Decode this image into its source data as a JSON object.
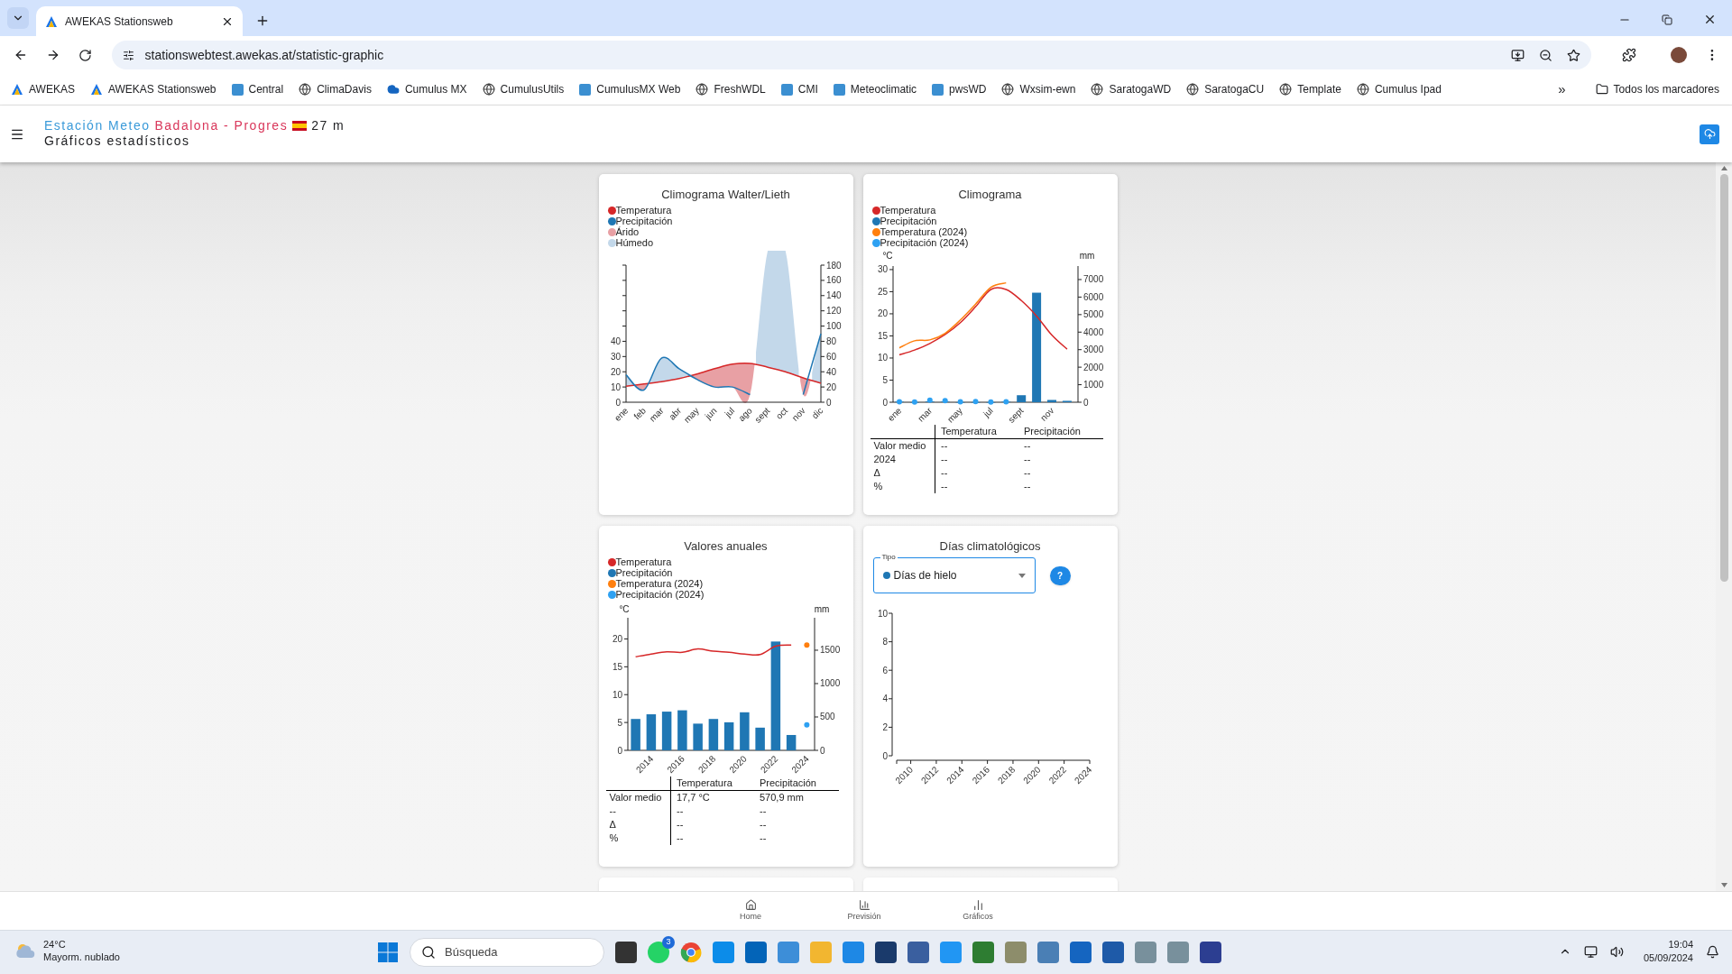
{
  "browser": {
    "tabs": [
      {
        "title": "AWEKAS Stationsweb",
        "selected": true
      }
    ],
    "url": "stationswebtest.awekas.at/statistic-graphic",
    "bookmarks": [
      {
        "label": "AWEKAS",
        "kind": "logo"
      },
      {
        "label": "AWEKAS Stationsweb",
        "kind": "logo"
      },
      {
        "label": "Central",
        "kind": "app"
      },
      {
        "label": "ClimaDavis",
        "kind": "globe"
      },
      {
        "label": "Cumulus MX",
        "kind": "cloud"
      },
      {
        "label": "CumulusUtils",
        "kind": "globe"
      },
      {
        "label": "CumulusMX Web",
        "kind": "app"
      },
      {
        "label": "FreshWDL",
        "kind": "globe"
      },
      {
        "label": "CMI",
        "kind": "app"
      },
      {
        "label": "Meteoclimatic",
        "kind": "app"
      },
      {
        "label": "pwsWD",
        "kind": "app"
      },
      {
        "label": "Wxsim-ewn",
        "kind": "globe"
      },
      {
        "label": "SaratogaWD",
        "kind": "globe"
      },
      {
        "label": "SaratogaCU",
        "kind": "globe"
      },
      {
        "label": "Template",
        "kind": "globe"
      },
      {
        "label": "Cumulus Ipad",
        "kind": "globe"
      }
    ],
    "overflow": "»",
    "all_bookmarks": "Todos los marcadores"
  },
  "header": {
    "title_part_1": "Estación Meteo",
    "title_part_2": "Badalona - Progres",
    "altitude": "27 m",
    "subtitle": "Gráficos estadísticos"
  },
  "cards": [
    {
      "kind": "walter",
      "title": "Climograma Walter/Lieth",
      "areas": [
        {
          "label": "Árido",
          "color": "#e8a0a4"
        },
        {
          "label": "Húmedo",
          "color": "#c3d8ea"
        }
      ],
      "chart_data": {
        "type": "line",
        "categories": [
          "ene",
          "feb",
          "mar",
          "abr",
          "may",
          "jun",
          "jul",
          "ago",
          "sept",
          "oct",
          "nov",
          "dic"
        ],
        "yticks": [
          0,
          10,
          20,
          30,
          40
        ],
        "ylim": [
          0,
          90
        ],
        "y2ticks": [
          0,
          20,
          40,
          60,
          80,
          100,
          120,
          140,
          160,
          180
        ],
        "y2lim": [
          0,
          180
        ],
        "series": [
          {
            "name": "Temperatura",
            "color": "#d62728",
            "values": [
              10.5,
              12,
              13.5,
              15.5,
              18.5,
              22,
              25,
              25.5,
              23,
              20,
              16,
              12.5
            ]
          },
          {
            "name": "Precipitación",
            "color": "#1f77b4",
            "axis": "y2",
            "values": [
              36,
              16,
              58,
              44,
              30,
              20,
              20,
              10,
              null,
              null,
              10,
              90
            ]
          }
        ]
      }
    },
    {
      "kind": "climogram",
      "title": "Climograma",
      "chart_data": {
        "type": "bar",
        "categories": [
          "ene",
          null,
          "mar",
          null,
          "may",
          null,
          "jul",
          null,
          "sept",
          null,
          "nov",
          null
        ],
        "ylabel": "°C",
        "y2label": "mm",
        "yticks": [
          0,
          5,
          10,
          15,
          20,
          25,
          30
        ],
        "ylim": [
          0,
          30.8
        ],
        "y2ticks": [
          0,
          1000,
          2000,
          3000,
          4000,
          5000,
          6000,
          7000
        ],
        "y2lim": [
          0,
          7771
        ],
        "series": [
          {
            "name": "Temperatura",
            "color": "#d62728",
            "type": "line",
            "values": [
              10.7,
              11.8,
              13.3,
              15.3,
              18,
              21.6,
              25.5,
              25.5,
              23,
              19.5,
              15.2,
              12
            ]
          },
          {
            "name": "Precipitación",
            "color": "#1f77b4",
            "axis": "y2",
            "values": [
              30,
              0,
              40,
              30,
              0,
              0,
              0,
              30,
              400,
              6250,
              130,
              80
            ]
          },
          {
            "name": "Temperatura (2024)",
            "color": "#ff7f0e",
            "type": "line",
            "values": [
              12.3,
              13.9,
              14.1,
              15.6,
              18.6,
              22.2,
              26,
              27,
              null,
              null,
              null,
              null
            ]
          },
          {
            "name": "Precipitación (2024)",
            "color": "#2ea1f2",
            "type": "scatter",
            "axis": "y2",
            "values": [
              20,
              10,
              120,
              90,
              20,
              40,
              10,
              20,
              null,
              null,
              null,
              null
            ]
          }
        ]
      },
      "table": {
        "columns": [
          "Temperatura",
          "Precipitación"
        ],
        "rows": [
          {
            "label": "Valor medio",
            "cells": [
              "--",
              "--"
            ]
          },
          {
            "label": "2024",
            "cells": [
              "--",
              "--"
            ]
          },
          {
            "label": "Δ",
            "cells": [
              "--",
              "--"
            ]
          },
          {
            "label": "%",
            "cells": [
              "--",
              "--"
            ]
          }
        ]
      }
    },
    {
      "kind": "annual",
      "title": "Valores anuales",
      "chart_data": {
        "type": "bar",
        "x": [
          2013,
          2014,
          2015,
          2016,
          2017,
          2018,
          2019,
          2020,
          2021,
          2022,
          2023,
          2024
        ],
        "xticks": [
          2014,
          2016,
          2018,
          2020,
          2022,
          2024
        ],
        "xlim": [
          2012.5,
          2024.5
        ],
        "ylabel": "°C",
        "y2label": "mm",
        "yticks": [
          0,
          5,
          10,
          15,
          20
        ],
        "ylim": [
          0,
          23.8
        ],
        "y2ticks": [
          0,
          500,
          1000,
          1500
        ],
        "y2lim": [
          0,
          1986
        ],
        "series": [
          {
            "name": "Temperatura",
            "color": "#d62728",
            "type": "line",
            "values": [
              16.8,
              17.3,
              17.7,
              17.6,
              18.2,
              17.8,
              17.6,
              17.3,
              17.2,
              18.7,
              18.9,
              null
            ]
          },
          {
            "name": "Precipitación",
            "color": "#1f77b4",
            "axis": "y2",
            "values": [
              470,
              540,
              580,
              600,
              400,
              470,
              420,
              570,
              340,
              1630,
              230,
              null
            ]
          },
          {
            "name": "Temperatura (2024)",
            "color": "#ff7f0e",
            "type": "scatter",
            "values": [
              null,
              null,
              null,
              null,
              null,
              null,
              null,
              null,
              null,
              null,
              null,
              18.9
            ]
          },
          {
            "name": "Precipitación (2024)",
            "color": "#2ea1f2",
            "type": "scatter",
            "axis": "y2",
            "values": [
              null,
              null,
              null,
              null,
              null,
              null,
              null,
              null,
              null,
              null,
              null,
              380
            ]
          }
        ]
      },
      "table": {
        "columns": [
          "Temperatura",
          "Precipitación"
        ],
        "rows": [
          {
            "label": "Valor medio",
            "cells": [
              "17,7 °C",
              "570,9 mm"
            ]
          },
          {
            "label": "--",
            "cells": [
              "--",
              "--"
            ]
          },
          {
            "label": "Δ",
            "cells": [
              "--",
              "--"
            ]
          },
          {
            "label": "%",
            "cells": [
              "--",
              "--"
            ]
          }
        ]
      }
    },
    {
      "kind": "days",
      "title": "Días climatológicos",
      "select": {
        "label": "Tipo",
        "value": "Días de hielo",
        "color": "#1f77b4"
      },
      "help": "?",
      "chart_data": {
        "type": "bar",
        "xticks": [
          2010,
          2012,
          2014,
          2016,
          2018,
          2020,
          2022,
          2024
        ],
        "xlim": [
          2008.9,
          2024
        ],
        "yticks": [
          0,
          2,
          4,
          6,
          8,
          10
        ],
        "ylim": [
          0,
          10
        ]
      }
    }
  ],
  "bottom_nav": [
    {
      "label": "Home",
      "kind": "home"
    },
    {
      "label": "Previsión",
      "kind": "forecast"
    },
    {
      "label": "Gráficos",
      "kind": "charts"
    }
  ],
  "taskbar": {
    "weather_temp": "24°C",
    "weather_text": "Mayorm. nublado",
    "search_placeholder": "Búsqueda",
    "badge": "3",
    "time": "19:04",
    "date": "05/09/2024"
  }
}
